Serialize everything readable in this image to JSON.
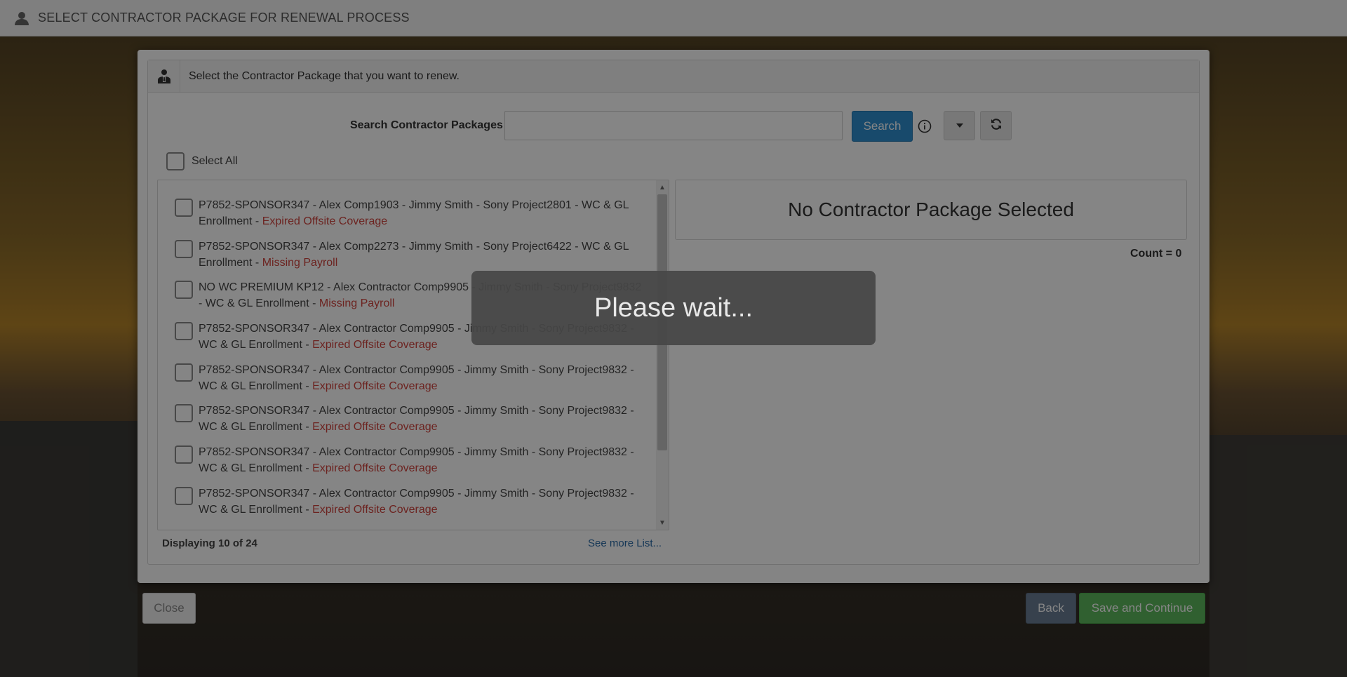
{
  "topbar": {
    "title": "SELECT CONTRACTOR PACKAGE FOR RENEWAL PROCESS",
    "icon": "user-icon"
  },
  "panel": {
    "header": "Select the Contractor Package that you want to renew.",
    "header_icon": "contractor-icon"
  },
  "search": {
    "label": "Search Contractor Packages",
    "value": "",
    "placeholder": "",
    "button_label": "Search"
  },
  "select_all_label": "Select All",
  "packages": [
    {
      "text": "P7852-SPONSOR347 - Alex Comp1903 - Jimmy Smith - Sony Project2801 - WC & GL Enrollment",
      "status": "Expired Offsite Coverage"
    },
    {
      "text": "P7852-SPONSOR347 - Alex Comp2273 - Jimmy Smith - Sony Project6422 - WC & GL Enrollment",
      "status": "Missing Payroll"
    },
    {
      "text": "NO WC PREMIUM KP12 - Alex Contractor Comp9905 - Jimmy Smith - Sony Project9832 - WC & GL Enrollment",
      "status": "Missing Payroll"
    },
    {
      "text": "P7852-SPONSOR347 - Alex Contractor Comp9905 - Jimmy Smith - Sony Project9832 - WC & GL Enrollment",
      "status": "Expired Offsite Coverage"
    },
    {
      "text": "P7852-SPONSOR347 - Alex Contractor Comp9905 - Jimmy Smith - Sony Project9832 - WC & GL Enrollment",
      "status": "Expired Offsite Coverage"
    },
    {
      "text": "P7852-SPONSOR347 - Alex Contractor Comp9905 - Jimmy Smith - Sony Project9832 - WC & GL Enrollment",
      "status": "Expired Offsite Coverage"
    },
    {
      "text": "P7852-SPONSOR347 - Alex Contractor Comp9905 - Jimmy Smith - Sony Project9832 - WC & GL Enrollment",
      "status": "Expired Offsite Coverage"
    },
    {
      "text": "P7852-SPONSOR347 - Alex Contractor Comp9905 - Jimmy Smith - Sony Project9832 - WC & GL Enrollment",
      "status": "Expired Offsite Coverage"
    }
  ],
  "status_separator": " - ",
  "displaying_text": "Displaying 10 of 24",
  "see_more_text": "See more List...",
  "selected_empty_text": "No Contractor Package Selected",
  "count_text": "Count = 0",
  "buttons": {
    "close": "Close",
    "back": "Back",
    "save": "Save and Continue"
  },
  "loading_text": "Please wait...",
  "colors": {
    "primary": "#2f8fd0",
    "success": "#5cb85c",
    "back": "#6a7d95",
    "status": "#d0443e",
    "link": "#2a6aa6"
  }
}
